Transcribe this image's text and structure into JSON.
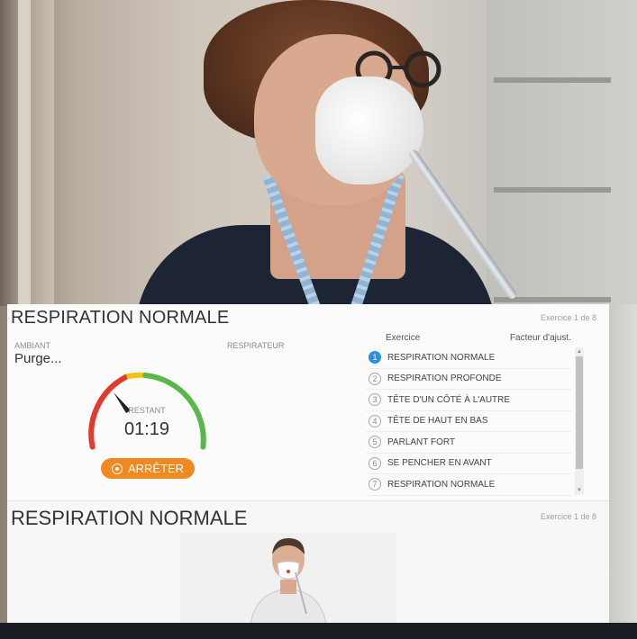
{
  "top_panel": {
    "title": "RESPIRATION NORMALE",
    "counter": "Exercice 1 de 8",
    "ambient_label": "AMBIANT",
    "ambient_value": "Purge...",
    "respirator_label": "RESPIRATEUR",
    "remaining_label": "RESTANT",
    "remaining_time": "01:19",
    "stop_button": "ARRÊTER",
    "gauge_colors": {
      "red": "#e23b2e",
      "yellow": "#f3c318",
      "green": "#59b84a",
      "needle": "#222222"
    }
  },
  "exercise_list": {
    "header_exercise": "Exercice",
    "header_factor": "Facteur d'ajust.",
    "active_index": 0,
    "accent_color": "#2f8fdf",
    "items": [
      {
        "num": "1",
        "label": "RESPIRATION NORMALE"
      },
      {
        "num": "2",
        "label": "RESPIRATION PROFONDE"
      },
      {
        "num": "3",
        "label": "TÊTE D'UN CÔTÉ À L'AUTRE"
      },
      {
        "num": "4",
        "label": "TÊTE DE HAUT EN BAS"
      },
      {
        "num": "5",
        "label": "PARLANT FORT"
      },
      {
        "num": "6",
        "label": "SE PENCHER EN AVANT"
      },
      {
        "num": "7",
        "label": "RESPIRATION NORMALE"
      }
    ]
  },
  "bottom_panel": {
    "title": "RESPIRATION NORMALE",
    "counter": "Exercice 1 de 8"
  },
  "colors": {
    "button_orange": "#f0891f"
  }
}
